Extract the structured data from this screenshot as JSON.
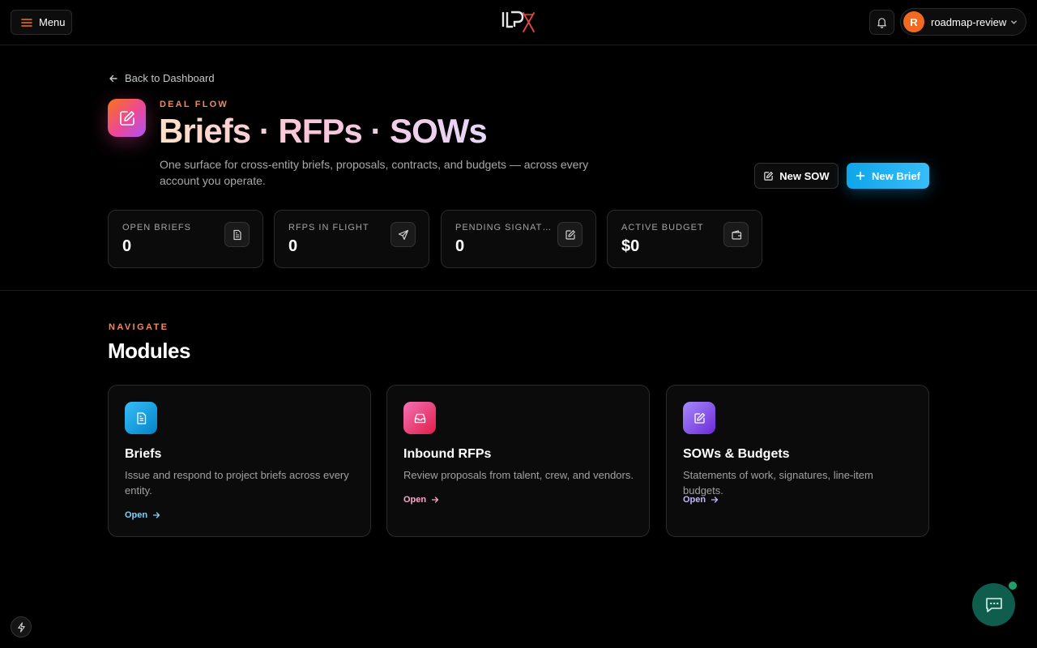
{
  "topbar": {
    "menu_label": "Menu",
    "user": {
      "initial": "R",
      "name": "roadmap-review"
    }
  },
  "header": {
    "back_label": "Back to Dashboard",
    "eyebrow": "DEAL FLOW",
    "title": "Briefs · RFPs · SOWs",
    "description": "One surface for cross-entity briefs, proposals, contracts, and budgets — across every account you operate.",
    "new_sow_label": "New SOW",
    "new_brief_label": "New Brief"
  },
  "stats": [
    {
      "label": "OPEN BRIEFS",
      "value": "0",
      "icon": "document-icon"
    },
    {
      "label": "RFPS IN FLIGHT",
      "value": "0",
      "icon": "send-icon"
    },
    {
      "label": "PENDING SIGNATURES",
      "value": "0",
      "icon": "edit-icon"
    },
    {
      "label": "ACTIVE BUDGET",
      "value": "$0",
      "icon": "wallet-icon"
    }
  ],
  "modules_section": {
    "eyebrow": "NAVIGATE",
    "title": "Modules",
    "items": [
      {
        "title": "Briefs",
        "description": "Issue and respond to project briefs across every entity.",
        "open_label": "Open",
        "icon": "document-icon",
        "accent": "#7dd3fc"
      },
      {
        "title": "Inbound RFPs",
        "description": "Review proposals from talent, crew, and vendors.",
        "open_label": "Open",
        "icon": "inbox-icon",
        "accent": "#f9a8c9"
      },
      {
        "title": "SOWs & Budgets",
        "description": "Statements of work, signatures, line-item budgets.",
        "open_label": "Open",
        "icon": "edit-icon",
        "accent": "#c4b5fd"
      }
    ]
  },
  "colors": {
    "accent_orange": "#f08a5d",
    "primary_blue": "#0ea5e9",
    "avatar_orange": "#f26a21",
    "chat_green": "#0f5d4d"
  }
}
